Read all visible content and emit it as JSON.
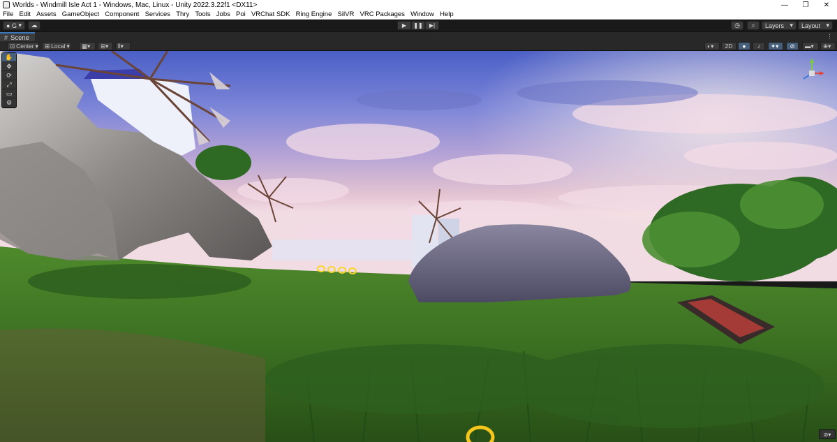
{
  "window": {
    "title": "Worlds - Windmill Isle Act 1 - Windows, Mac, Linux - Unity 2022.3.22f1 <DX11>",
    "controls": [
      "—",
      "❐",
      "✕"
    ]
  },
  "menu": [
    "File",
    "Edit",
    "Assets",
    "GameObject",
    "Component",
    "Services",
    "Thry",
    "Tools",
    "Jobs",
    "Poi",
    "VRChat SDK",
    "Ring Engine",
    "SilVR",
    "VRC Packages",
    "Window",
    "Help"
  ],
  "toolbar": {
    "account_label": "G",
    "account_icon": "account-icon",
    "cloud_icon": "cloud-icon",
    "play_icon": "▶",
    "pause_icon": "❚❚",
    "step_icon": "▶|",
    "history_icon": "history-icon",
    "search_icon": "search-icon",
    "layers_label": "Layers",
    "layout_label": "Layout",
    "gear_icon": "⋮"
  },
  "scene_tab": {
    "label": "Scene"
  },
  "scene_toolbar": {
    "pivot_label": "Center",
    "space_label": "Local",
    "view_2d_label": "2D"
  },
  "tools": [
    "✋",
    "✥",
    "⟳",
    "⤢",
    "▭",
    "⚙"
  ],
  "colors": {
    "accent": "#3a79bb",
    "editor_bg": "#191919",
    "panel_bg": "#282828"
  }
}
